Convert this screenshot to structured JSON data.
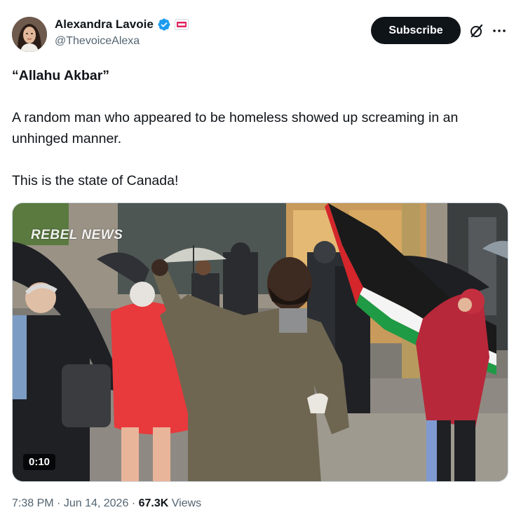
{
  "author": {
    "name": "Alexandra Lavoie",
    "handle": "@ThevoiceAlexa"
  },
  "actions": {
    "subscribe_label": "Subscribe",
    "grok_icon": "grok-slash-icon",
    "more_icon": "more-dots-icon"
  },
  "tweet": {
    "line1": "“Allahu Akbar”",
    "line2": "A random man who appeared to be homeless showed up screaming in an unhinged manner.",
    "line3": "This is the state of Canada!"
  },
  "media": {
    "watermark": "REBEL NEWS",
    "duration": "0:10"
  },
  "meta": {
    "time": "7:38 PM",
    "date": "Jun 14, 2026",
    "views_count": "67.3K",
    "views_label": "Views"
  },
  "colors": {
    "verified_blue": "#1d9bf0",
    "text": "#0f1419",
    "secondary": "#536471"
  }
}
